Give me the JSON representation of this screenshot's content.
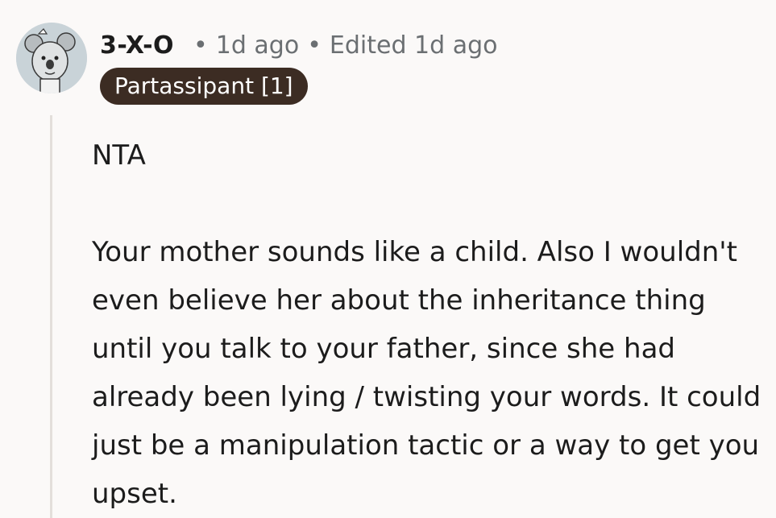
{
  "comment": {
    "author": "3-X-O",
    "age": "1d ago",
    "edited": "Edited 1d ago",
    "separator": "•",
    "flair": "Partassipant [1]",
    "avatar_icon": "koala-avatar-icon",
    "body": [
      "NTA",
      "Your mother sounds like a child. Also I wouldn't even believe her about the inheritance thing until you talk to your father, since she had already been lying / twisting your words. It could just be a manipulation tactic or a way to get you upset."
    ]
  },
  "colors": {
    "background": "#fbf9f8",
    "text": "#1c1c1c",
    "meta": "#6b6f72",
    "flair_bg": "#3c2c23",
    "flair_text": "#ffffff",
    "thread_line": "#e3dfdb"
  }
}
